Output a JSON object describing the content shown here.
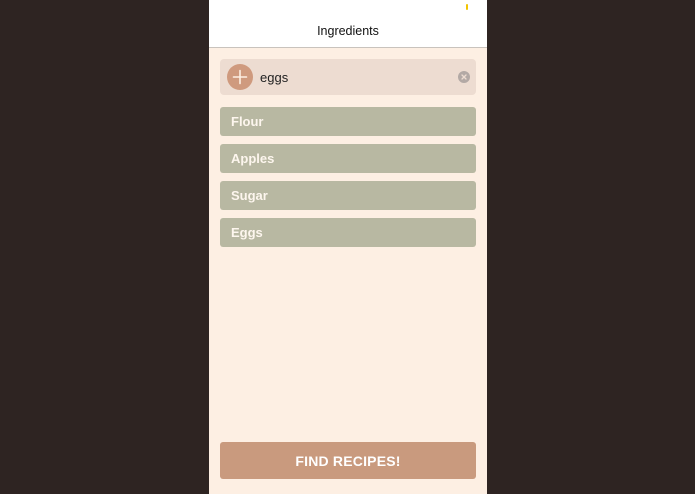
{
  "nav": {
    "title": "Ingredients"
  },
  "input": {
    "value": "eggs",
    "add_icon": "plus-icon",
    "clear_icon": "clear-circle-icon"
  },
  "ingredients": [
    {
      "label": "Flour"
    },
    {
      "label": "Apples"
    },
    {
      "label": "Sugar"
    },
    {
      "label": "Eggs"
    }
  ],
  "find_button": {
    "label": "FIND RECIPES!"
  },
  "colors": {
    "backdrop": "#2e2422",
    "screen_background": "#fdefe3",
    "nav_background": "#ffffff",
    "input_background": "#eddcd1",
    "add_button": "#cf9a7e",
    "list_item": "#b8b8a2",
    "find_button": "#c99a7e",
    "clear_button": "#b3a9a5",
    "status_mark": "#f2c500"
  }
}
